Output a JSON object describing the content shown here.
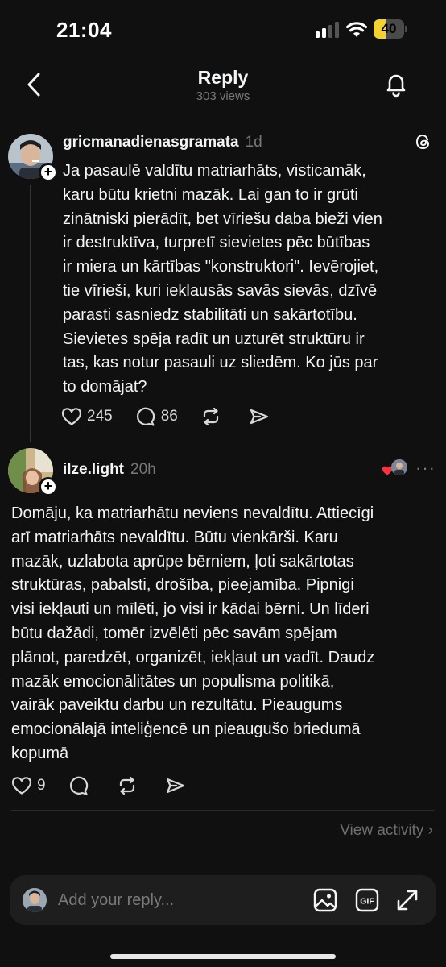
{
  "status_bar": {
    "time": "21:04",
    "battery_level": "40",
    "battery_fraction": 0.4
  },
  "header": {
    "title": "Reply",
    "subtitle": "303 views"
  },
  "post": {
    "username": "gricmanadienasgramata",
    "time_ago": "1d",
    "lines": [
      "Ja pasaulē valdītu matriarhāts, visticamāk,",
      "karu būtu krietni mazāk. Lai gan to ir grūti",
      "zinātniski pierādīt, bet vīriešu daba bieži vien",
      "ir destruktīva, turpretī sievietes pēc būtības",
      "ir miera un kārtības \"konstruktori\". Ievērojiet,",
      "tie vīrieši, kuri ieklausās savās sievās, dzīvē",
      "parasti sasniedz stabilitāti un sakārtotību.",
      "Sievietes spēja radīt un uzturēt struktūru ir",
      "tas, kas notur pasauli uz sliedēm. Ko jūs par",
      "to domājat?"
    ],
    "likes": "245",
    "comments": "86"
  },
  "reply": {
    "username": "ilze.light",
    "time_ago": "20h",
    "more": "···",
    "lines": [
      "Domāju, ka matriarhātu neviens nevaldītu. Attiecīgi",
      "arī matriarhāts nevaldītu. Būtu vienkārši. Karu",
      "mazāk, uzlabota aprūpe bērniem, ļoti sakārtotas",
      "struktūras, pabalsti, drošība, pieejamība. Pipnigi",
      "visi iekļauti un mīlēti, jo visi ir kādai bērni. Un līderi",
      "būtu dažādi, tomēr izvēlēti pēc savām spējam",
      "plānot, paredzēt, organizēt, iekļaut un vadīt. Daudz",
      "mazāk emocionālitātes un populisma politikā,",
      "vairāk paveiktu darbu un rezultātu. Pieaugums",
      "emocionālajā inteliģencē un pieaugušo briedumā",
      "kopumā"
    ],
    "likes": "9"
  },
  "view_activity": "View activity ›",
  "reply_bar": {
    "placeholder": "Add your reply..."
  },
  "icons": {
    "back": "chevron-left-icon",
    "bell": "bell-icon",
    "threads": "threads-logo-icon",
    "heart": "heart-icon",
    "comment": "comment-icon",
    "repost": "repost-icon",
    "share": "share-icon",
    "image": "image-icon",
    "gif": "gif-icon",
    "expand": "expand-icon"
  },
  "colors": {
    "background": "#101010",
    "text": "#f3f5f7",
    "muted": "#777777",
    "battery": "#f2d230",
    "heart_red": "#ff3040"
  }
}
